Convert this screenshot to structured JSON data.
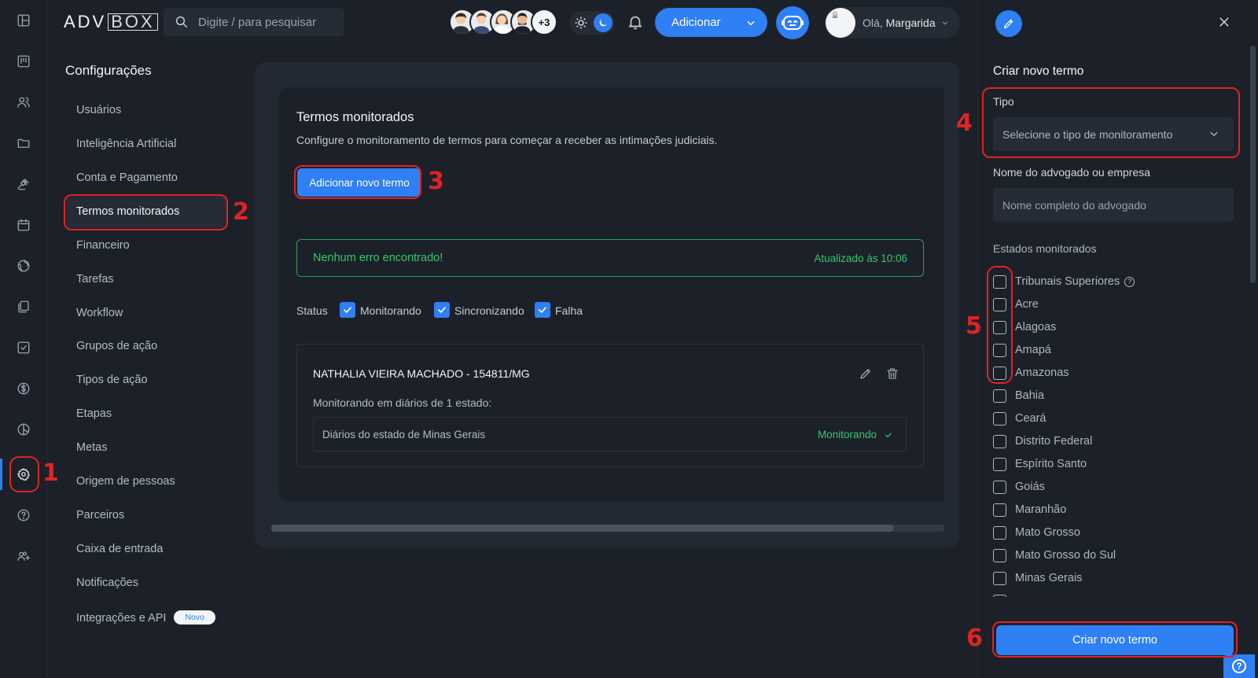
{
  "app": {
    "logo_left": "ADV",
    "logo_right": "BOX"
  },
  "search": {
    "placeholder": "Digite / para pesquisar"
  },
  "header": {
    "avatars_more": "+3",
    "add_label": "Adicionar",
    "greeting": "Olá,",
    "user_name": "Margarida"
  },
  "rail": {
    "icons": [
      "dashboard-icon",
      "kanban-icon",
      "people-icon",
      "folder-icon",
      "gavel-icon",
      "calendar-icon",
      "globe-icon",
      "documents-icon",
      "checklist-icon",
      "money-icon",
      "chart-icon",
      "settings-icon",
      "help-icon",
      "add-users-icon"
    ],
    "active": "settings-icon"
  },
  "menu": {
    "title": "Configurações",
    "items": [
      "Usuários",
      "Inteligência Artificial",
      "Conta e Pagamento",
      "Termos monitorados",
      "Financeiro",
      "Tarefas",
      "Workflow",
      "Grupos de ação",
      "Tipos de ação",
      "Etapas",
      "Metas",
      "Origem de pessoas",
      "Parceiros",
      "Caixa de entrada",
      "Notificações",
      "Integrações e API"
    ],
    "active": "Termos monitorados",
    "new_badge": "Novo"
  },
  "main": {
    "title": "Termos monitorados",
    "subtitle": "Configure o monitoramento de termos para começar a receber as intimações judiciais.",
    "add_button": "Adicionar novo termo",
    "success_message": "Nenhum erro encontrado!",
    "updated_at": "Atualizado às 10:06",
    "status_label": "Status",
    "status_filters": [
      "Monitorando",
      "Sincronizando",
      "Falha"
    ],
    "term": {
      "name": "NATHALIA VIEIRA MACHADO - 154811/MG",
      "monitoring_text": "Monitorando em diários de 1 estado:",
      "state_row": "Diários do estado de Minas Gerais",
      "state_status": "Monitorando"
    }
  },
  "drawer": {
    "title": "Criar novo termo",
    "type_label": "Tipo",
    "type_placeholder": "Selecione o tipo de monitoramento",
    "name_label": "Nome do advogado ou empresa",
    "name_placeholder": "Nome completo do advogado",
    "states_label": "Estados monitorados",
    "states": [
      "Tribunais Superiores",
      "Acre",
      "Alagoas",
      "Amapá",
      "Amazonas",
      "Bahia",
      "Ceará",
      "Distrito Federal",
      "Espírito Santo",
      "Goiás",
      "Maranhão",
      "Mato Grosso",
      "Mato Grosso do Sul",
      "Minas Gerais"
    ],
    "create_button": "Criar novo termo",
    "help_mark": "?"
  },
  "annotations": [
    "1",
    "2",
    "3",
    "4",
    "5",
    "6"
  ],
  "colors": {
    "accent": "#2f7ff5",
    "success": "#35c46f",
    "annotation": "#e02323",
    "background": "#1c2129"
  }
}
